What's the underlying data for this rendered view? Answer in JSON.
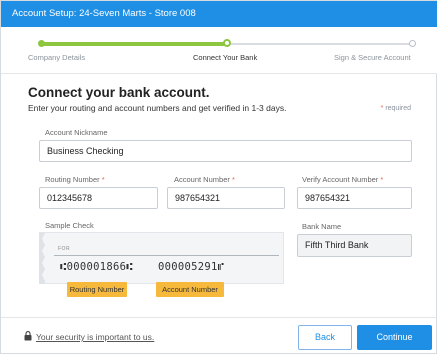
{
  "header": {
    "title": "Account Setup: 24-Seven Marts - Store 008"
  },
  "progress": {
    "fraction_complete": 0.5,
    "steps": [
      {
        "label": "Company Details",
        "state": "done"
      },
      {
        "label": "Connect Your Bank",
        "state": "current"
      },
      {
        "label": "Sign & Secure Account",
        "state": "upcoming"
      }
    ]
  },
  "main": {
    "title": "Connect your bank account.",
    "subtitle": "Enter your routing and account numbers and get verified in 1-3 days.",
    "required_star": "*",
    "required_text": "required"
  },
  "form": {
    "nickname": {
      "label": "Account Nickname",
      "value": "Business Checking"
    },
    "routing": {
      "label": "Routing Number",
      "star": "*",
      "value": "012345678"
    },
    "account": {
      "label": "Account Number",
      "star": "*",
      "value": "987654321"
    },
    "verify": {
      "label": "Verify Account Number",
      "star": "*",
      "value": "987654321"
    },
    "bank_name": {
      "label": "Bank Name",
      "value": "Fifth Third Bank"
    }
  },
  "sample_check": {
    "label": "Sample Check",
    "for_text": "FOR",
    "routing_micr": "⑆000001866⑆",
    "account_micr": "000005291⑈",
    "routing_callout": "Routing Number",
    "account_callout": "Account Number"
  },
  "footer": {
    "security_link": "Your security is important to us.",
    "back_label": "Back",
    "continue_label": "Continue"
  },
  "colors": {
    "header_blue": "#1f8fe5",
    "progress_green": "#8dc63f",
    "callout_orange": "#f6b93b",
    "required_star": "#e26a4a"
  }
}
